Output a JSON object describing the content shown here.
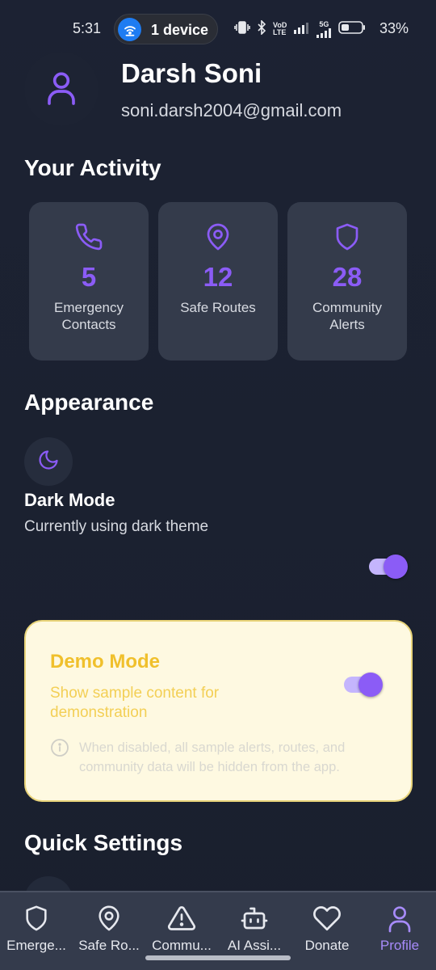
{
  "status_bar": {
    "time": "5:31",
    "hotspot_label": "1 device",
    "network_tag_top": "VoD",
    "network_tag_bottom": "LTE",
    "network_5g": "5G",
    "battery_text": "33%"
  },
  "profile": {
    "name": "Darsh Soni",
    "email": "soni.darsh2004@gmail.com"
  },
  "activity": {
    "title": "Your Activity",
    "cards": [
      {
        "icon": "phone-icon",
        "value": "5",
        "label": "Emergency Contacts"
      },
      {
        "icon": "map-pin-icon",
        "value": "12",
        "label": "Safe Routes"
      },
      {
        "icon": "shield-icon",
        "value": "28",
        "label": "Community Alerts"
      }
    ]
  },
  "appearance": {
    "title": "Appearance",
    "dark_mode_title": "Dark Mode",
    "dark_mode_subtitle": "Currently using dark theme",
    "dark_mode_on": true
  },
  "demo_mode": {
    "title": "Demo Mode",
    "subtitle": "Show sample content for demonstration",
    "note": "When disabled, all sample alerts, routes, and community data will be hidden from the app.",
    "enabled": true
  },
  "quick_settings": {
    "title": "Quick Settings"
  },
  "bottom_nav": {
    "items": [
      {
        "label": "Emerge...",
        "icon": "shield-icon",
        "active": false
      },
      {
        "label": "Safe Ro...",
        "icon": "map-pin-icon",
        "active": false
      },
      {
        "label": "Commu...",
        "icon": "alert-triangle-icon",
        "active": false
      },
      {
        "label": "AI Assi...",
        "icon": "bot-icon",
        "active": false
      },
      {
        "label": "Donate",
        "icon": "heart-icon",
        "active": false
      },
      {
        "label": "Profile",
        "icon": "user-icon",
        "active": true
      }
    ]
  },
  "colors": {
    "accent": "#8b5cf6",
    "background": "#1b2130",
    "card": "#343b4b",
    "demo_bg": "#fef9e1",
    "demo_accent": "#f0c02c"
  }
}
